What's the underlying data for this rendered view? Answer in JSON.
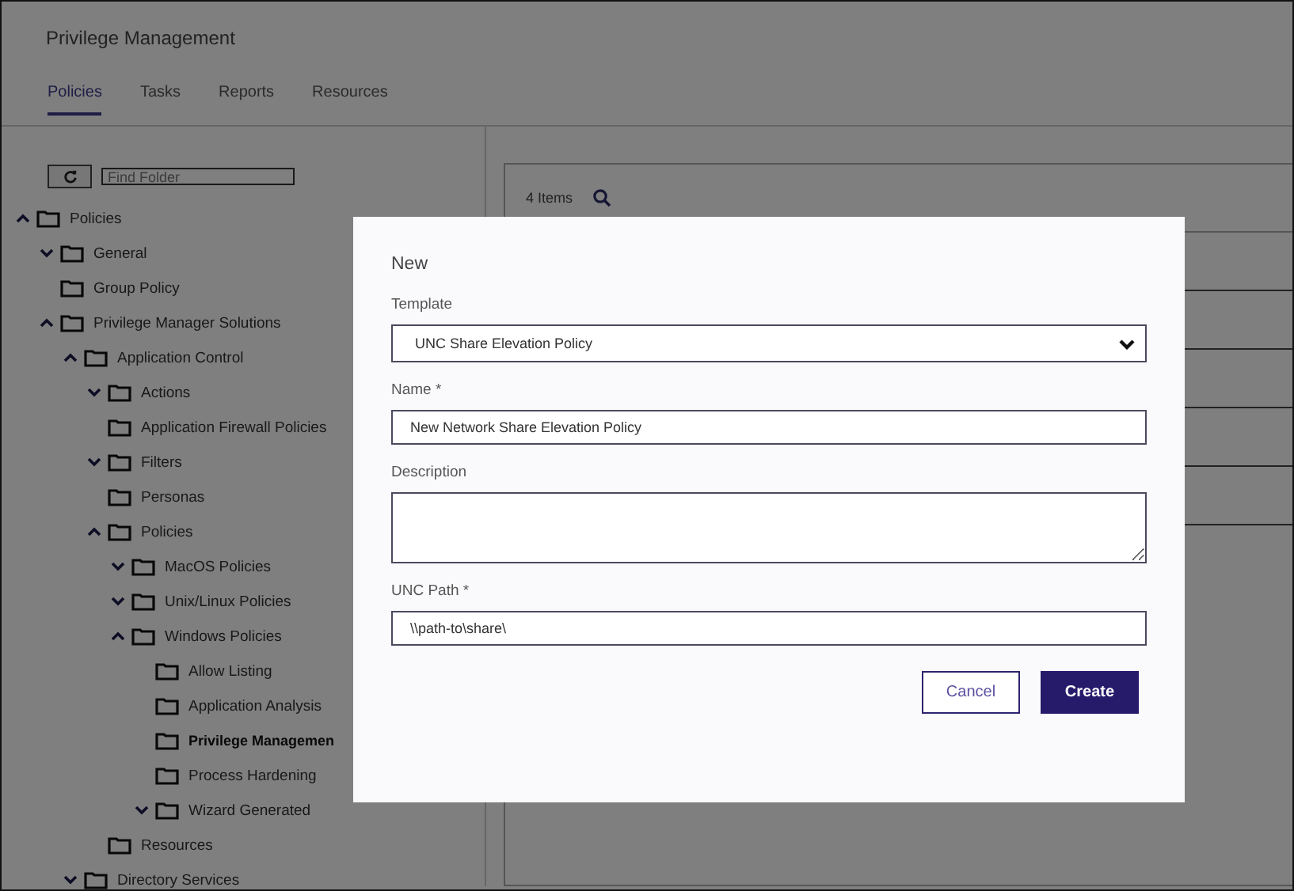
{
  "app": {
    "title": "Privilege Management"
  },
  "tabs": [
    {
      "label": "Policies",
      "selected": true
    },
    {
      "label": "Tasks",
      "selected": false
    },
    {
      "label": "Reports",
      "selected": false
    },
    {
      "label": "Resources",
      "selected": false
    }
  ],
  "folder_search": {
    "placeholder": "Find Folder"
  },
  "tree": [
    {
      "label": "Policies",
      "selected": false,
      "expanded": true,
      "children": [
        {
          "label": "General",
          "selected": false,
          "expanded": false
        },
        {
          "label": "Group Policy",
          "selected": false
        },
        {
          "label": "Privilege Manager Solutions",
          "selected": false,
          "expanded": true,
          "children": [
            {
              "label": "Application Control",
              "selected": false,
              "expanded": true,
              "children": [
                {
                  "label": "Actions",
                  "selected": false,
                  "expanded": false
                },
                {
                  "label": "Application Firewall Policies",
                  "selected": false
                },
                {
                  "label": "Filters",
                  "selected": false,
                  "expanded": false
                },
                {
                  "label": "Personas",
                  "selected": false
                },
                {
                  "label": "Policies",
                  "selected": false,
                  "expanded": true,
                  "children": [
                    {
                      "label": "MacOS Policies",
                      "selected": false,
                      "expanded": false
                    },
                    {
                      "label": "Unix/Linux Policies",
                      "selected": false,
                      "expanded": false
                    },
                    {
                      "label": "Windows Policies",
                      "selected": false,
                      "expanded": true,
                      "children": [
                        {
                          "label": "Allow Listing",
                          "selected": false
                        },
                        {
                          "label": "Application Analysis",
                          "selected": false
                        },
                        {
                          "label": "Privilege Managemen",
                          "selected": true
                        },
                        {
                          "label": "Process Hardening",
                          "selected": false
                        },
                        {
                          "label": "Wizard Generated",
                          "selected": false,
                          "expanded": false
                        }
                      ]
                    }
                  ]
                },
                {
                  "label": "Resources",
                  "selected": false
                }
              ]
            },
            {
              "label": "Directory Services",
              "selected": false,
              "expanded": false
            }
          ]
        }
      ]
    }
  ],
  "list": {
    "count": "4 Items"
  },
  "dialog": {
    "title": "New",
    "fields": [
      {
        "kind": "select",
        "label": "Template",
        "value": "UNC Share Elevation Policy"
      },
      {
        "kind": "text",
        "label": "Name *",
        "value": "New Network Share Elevation Policy"
      },
      {
        "kind": "textarea",
        "label": "Description"
      },
      {
        "kind": "text",
        "label": "UNC Path *",
        "value": "\\\\path-to\\share\\"
      }
    ],
    "buttons": [
      {
        "kind": "secondary",
        "label": "Cancel"
      },
      {
        "kind": "primary",
        "label": "Create"
      }
    ]
  }
}
